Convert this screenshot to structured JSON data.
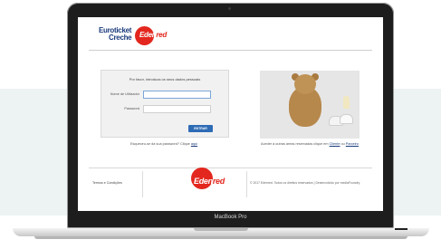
{
  "brand": {
    "line1": "Euroticket",
    "line2": "Creche",
    "logo_prefix": "Eden",
    "logo_suffix": "red",
    "logo_color": "#e3271e"
  },
  "login": {
    "title": "Por favor, introduza os seus dados pessoais",
    "username_label": "Nome de Utilizador",
    "password_label": "Password",
    "submit_label": "ENTRAR",
    "forgot_text": "Esqueceu-se da sua password? Clique",
    "forgot_link": "aqui"
  },
  "promo": {
    "access_text": "Aceder à outras áreas reservadas clique em",
    "client_link": "Cliente",
    "or_text": "ou",
    "partner_link": "Parceiro"
  },
  "footer": {
    "terms_label": "Termos e Condições",
    "copyright": "© 2017 Edenred. Todos os direitos reservados | Desenvolvido por mediaFoundry"
  },
  "device": {
    "model_label": "MacBook Pro"
  },
  "icons": [
    "teddy-bear-photo"
  ]
}
